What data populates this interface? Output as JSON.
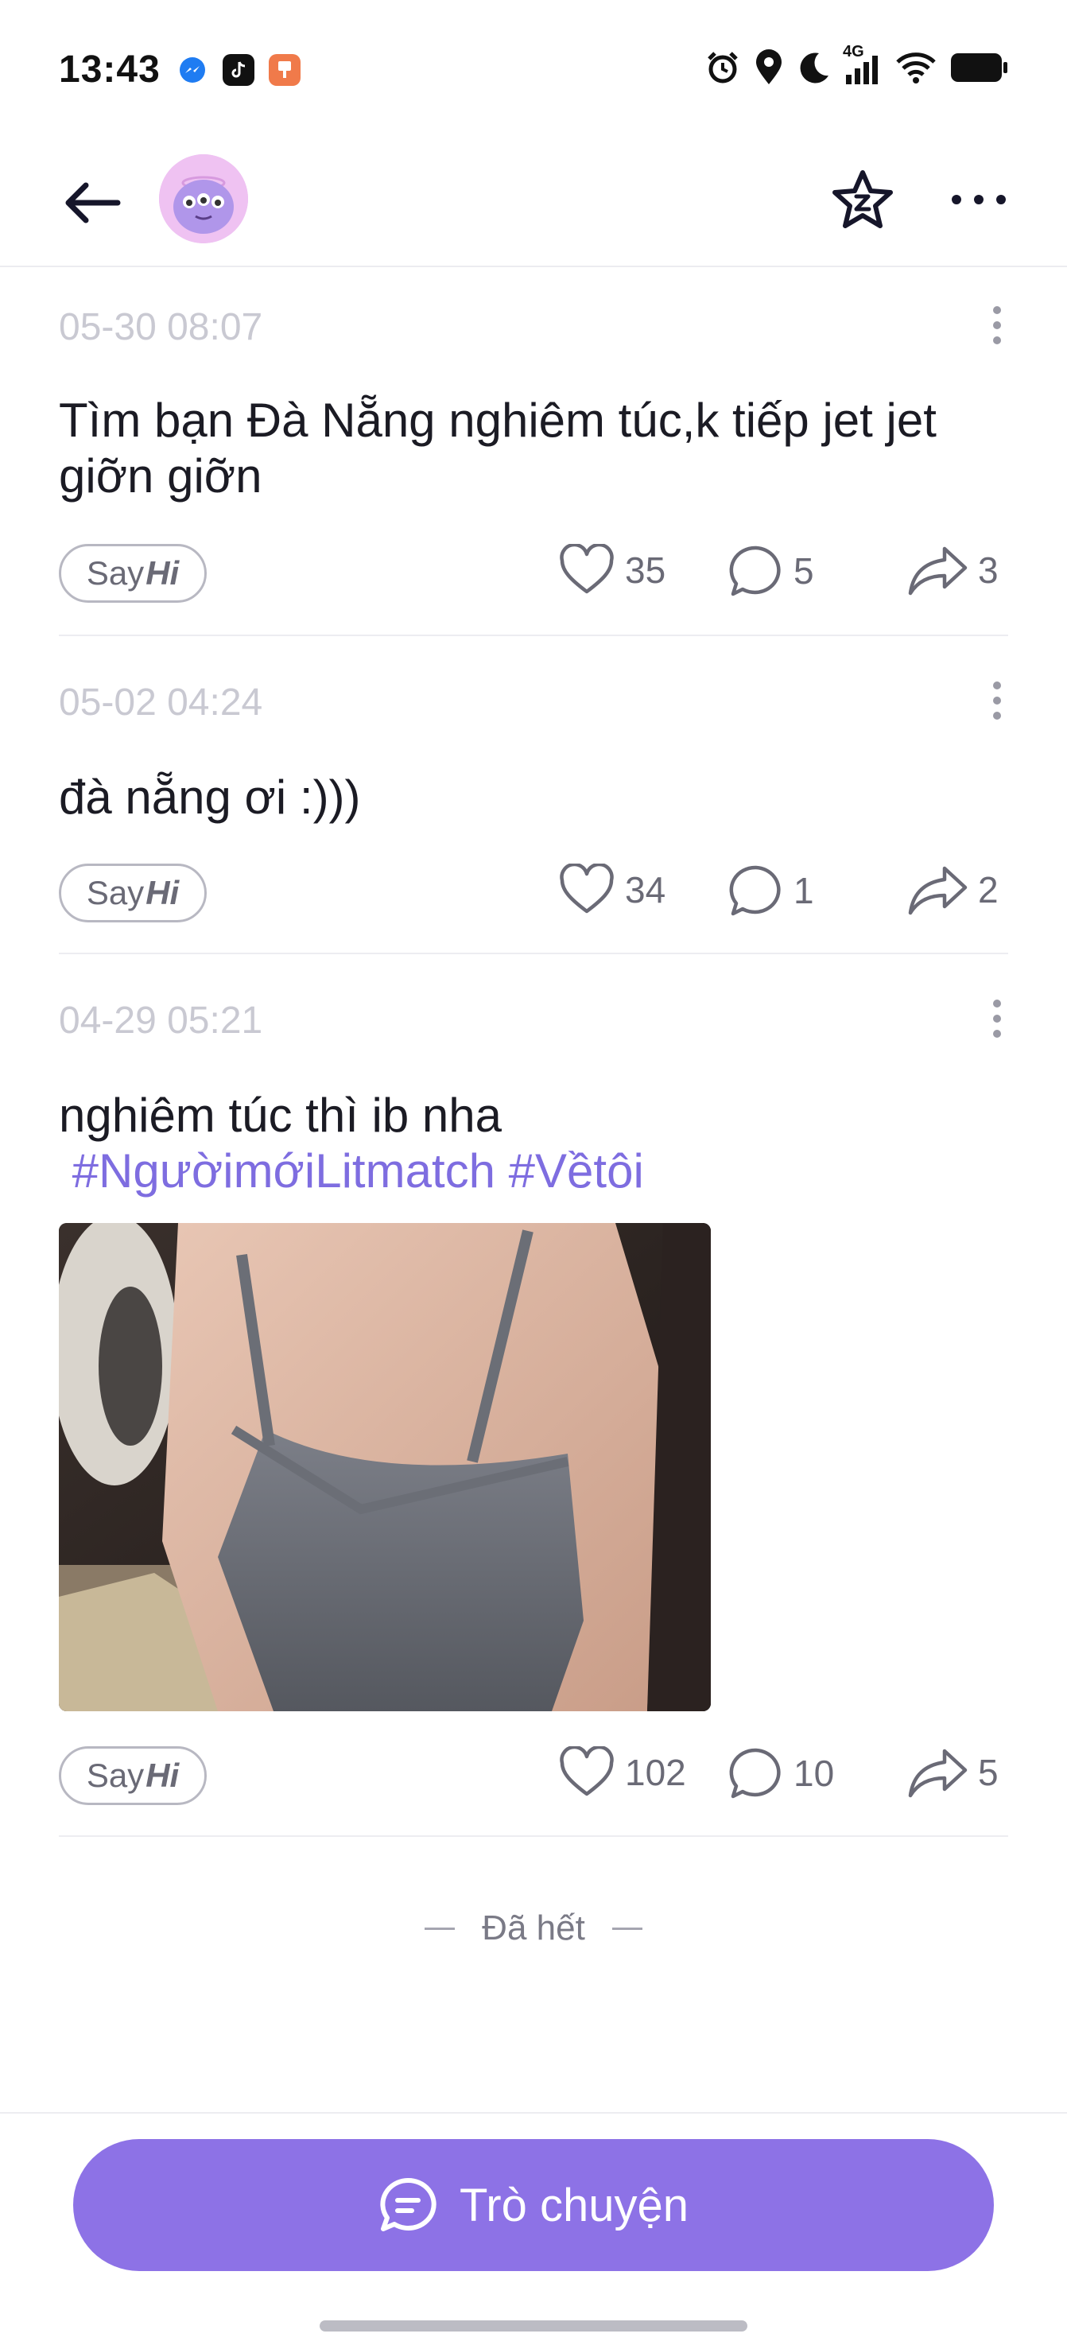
{
  "status_bar": {
    "time": "13:43",
    "network": "4G"
  },
  "header": {
    "avatar_icon": "purple-monster-avatar",
    "star_icon": "star-badge-icon",
    "more_icon": "more-horizontal-icon"
  },
  "posts": [
    {
      "date": "05-30 08:07",
      "text": "Tìm bạn Đà Nẵng nghiêm túc,k tiếp jet jet giỡn giỡn",
      "hashtags": "",
      "sayhi_prefix": "Say",
      "sayhi_hi": "Hi",
      "likes": "35",
      "comments": "5",
      "shares": "3"
    },
    {
      "date": "05-02 04:24",
      "text": "đà nẵng ơi :)))",
      "hashtags": "",
      "sayhi_prefix": "Say",
      "sayhi_hi": "Hi",
      "likes": "34",
      "comments": "1",
      "shares": "2"
    },
    {
      "date": "04-29 05:21",
      "text": "nghiêm túc thì ib nha",
      "hashtags": " #NgườimớiLitmatch #Vềtôi",
      "sayhi_prefix": "Say",
      "sayhi_hi": "Hi",
      "likes": "102",
      "comments": "10",
      "shares": "5"
    }
  ],
  "end_note": "Đã hết",
  "chat_button": {
    "label": "Trò chuyện"
  },
  "colors": {
    "accent": "#8d72e6",
    "hashtag": "#7e6de0",
    "date": "#c9c9d2",
    "muted": "#6a6a76"
  }
}
